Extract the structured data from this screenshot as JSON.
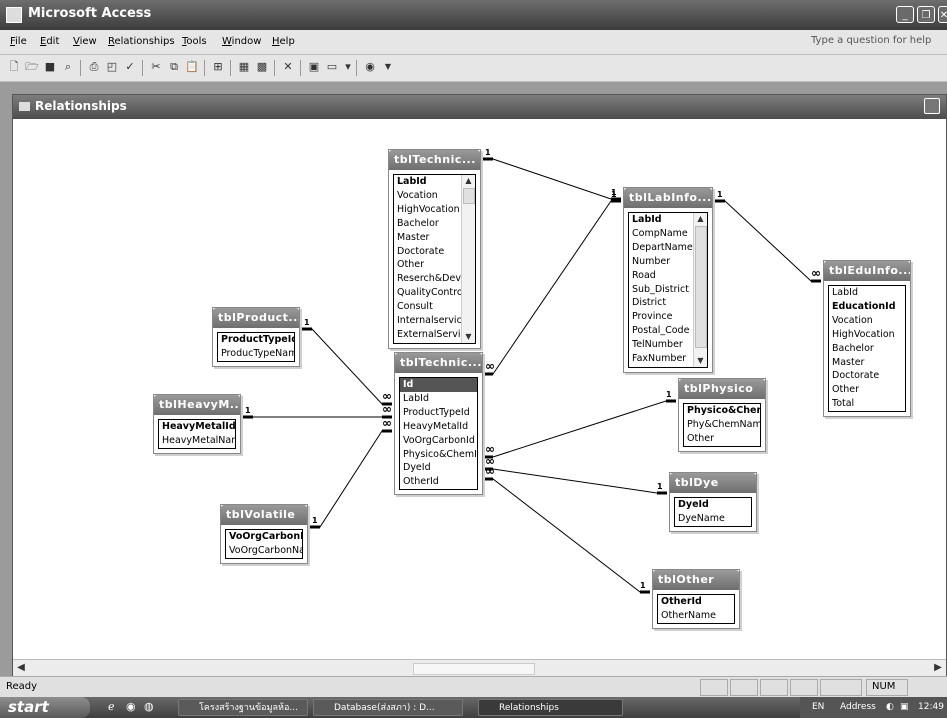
{
  "app": {
    "title": "Microsoft Access"
  },
  "menu": {
    "items": [
      {
        "accel": "F",
        "rest": "ile"
      },
      {
        "accel": "E",
        "rest": "dit"
      },
      {
        "accel": "V",
        "rest": "iew"
      },
      {
        "accel": "R",
        "rest": "elationships"
      },
      {
        "accel": "T",
        "rest": "ools"
      },
      {
        "accel": "W",
        "rest": "indow"
      },
      {
        "accel": "H",
        "rest": "elp"
      }
    ],
    "help_placeholder": "Type a question for help"
  },
  "relwin": {
    "title": "Relationships"
  },
  "tables": [
    {
      "id": "tblTechnic1",
      "title": "tblTechnic...",
      "fields": [
        {
          "name": "LabId",
          "key": true
        },
        {
          "name": "Vocation"
        },
        {
          "name": "HighVocation"
        },
        {
          "name": "Bachelor"
        },
        {
          "name": "Master"
        },
        {
          "name": "Doctorate"
        },
        {
          "name": "Other"
        },
        {
          "name": "Reserch&Deve"
        },
        {
          "name": "QualityControl"
        },
        {
          "name": "Consult"
        },
        {
          "name": "Internalservice"
        },
        {
          "name": "ExternalServic"
        }
      ]
    },
    {
      "id": "tblLabInfo",
      "title": "tblLabInfo...",
      "fields": [
        {
          "name": "LabId",
          "key": true
        },
        {
          "name": "CompName"
        },
        {
          "name": "DepartName"
        },
        {
          "name": "Number"
        },
        {
          "name": "Road"
        },
        {
          "name": "Sub_District"
        },
        {
          "name": "District"
        },
        {
          "name": "Province"
        },
        {
          "name": "Postal_Code"
        },
        {
          "name": "TelNumber"
        },
        {
          "name": "FaxNumber"
        }
      ]
    },
    {
      "id": "tblEduInfo",
      "title": "tblEduInfo...",
      "fields": [
        {
          "name": "LabId"
        },
        {
          "name": "EducationId",
          "key": true
        },
        {
          "name": "Vocation"
        },
        {
          "name": "HighVocation"
        },
        {
          "name": "Bachelor"
        },
        {
          "name": "Master"
        },
        {
          "name": "Doctorate"
        },
        {
          "name": "Other"
        },
        {
          "name": "Total"
        }
      ]
    },
    {
      "id": "tblProduct",
      "title": "tblProduct...",
      "fields": [
        {
          "name": "ProductTypeId",
          "key": true
        },
        {
          "name": "ProducTypeName"
        }
      ]
    },
    {
      "id": "tblTechnic2",
      "title": "tblTechnic...",
      "fields": [
        {
          "name": "Id",
          "key": true,
          "selected": true
        },
        {
          "name": "LabId"
        },
        {
          "name": "ProductTypeId"
        },
        {
          "name": "HeavyMetalId"
        },
        {
          "name": "VoOrgCarbonId"
        },
        {
          "name": "Physico&ChemId"
        },
        {
          "name": "DyeId"
        },
        {
          "name": "OtherId"
        }
      ]
    },
    {
      "id": "tblHeavyM",
      "title": "tblHeavyM...",
      "fields": [
        {
          "name": "HeavyMetalId",
          "key": true
        },
        {
          "name": "HeavyMetalName"
        }
      ]
    },
    {
      "id": "tblPhysico",
      "title": "tblPhysico",
      "fields": [
        {
          "name": "Physico&ChemId",
          "key": true
        },
        {
          "name": "Phy&ChemName"
        },
        {
          "name": "Other"
        }
      ]
    },
    {
      "id": "tblDye",
      "title": "tblDye",
      "fields": [
        {
          "name": "DyeId",
          "key": true
        },
        {
          "name": "DyeName"
        }
      ]
    },
    {
      "id": "tblVolatile",
      "title": "tblVolatile",
      "fields": [
        {
          "name": "VoOrgCarbonId",
          "key": true
        },
        {
          "name": "VoOrgCarbonNan"
        }
      ]
    },
    {
      "id": "tblOther",
      "title": "tblOther",
      "fields": [
        {
          "name": "OtherId",
          "key": true
        },
        {
          "name": "OtherName"
        }
      ]
    }
  ],
  "relationships": [
    {
      "from": "tblTechnic1",
      "to": "tblLabInfo",
      "from_card": "1",
      "to_card": "1"
    },
    {
      "from": "tblLabInfo",
      "to": "tblEduInfo",
      "from_card": "1",
      "to_card": "∞"
    },
    {
      "from": "tblLabInfo",
      "to": "tblTechnic2",
      "from_card": "1",
      "to_card": "∞"
    },
    {
      "from": "tblProduct",
      "to": "tblTechnic2",
      "from_card": "1",
      "to_card": "∞"
    },
    {
      "from": "tblHeavyM",
      "to": "tblTechnic2",
      "from_card": "1",
      "to_card": "∞"
    },
    {
      "from": "tblVolatile",
      "to": "tblTechnic2",
      "from_card": "1",
      "to_card": "∞"
    },
    {
      "from": "tblPhysico",
      "to": "tblTechnic2",
      "from_card": "1",
      "to_card": "∞"
    },
    {
      "from": "tblDye",
      "to": "tblTechnic2",
      "from_card": "1",
      "to_card": "∞"
    },
    {
      "from": "tblOther",
      "to": "tblTechnic2",
      "from_card": "1",
      "to_card": "∞"
    }
  ],
  "status": {
    "left": "Ready",
    "num": "NUM"
  },
  "taskbar": {
    "start": "start",
    "tasks": [
      "โครงสร้างฐานข้อมูลห้อ...",
      "Database(ส่งสภา) : D...",
      "Relationships"
    ],
    "lang": "EN",
    "address": "Address",
    "clock": "12:49"
  }
}
